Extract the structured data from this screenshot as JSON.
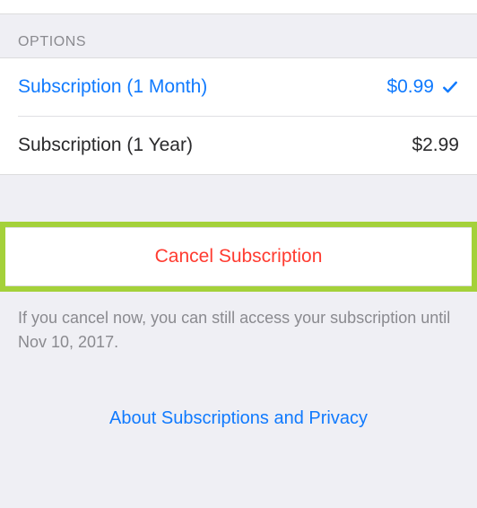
{
  "section_header": "Options",
  "options": [
    {
      "label": "Subscription (1 Month)",
      "price": "$0.99",
      "selected": true
    },
    {
      "label": "Subscription (1 Year)",
      "price": "$2.99",
      "selected": false
    }
  ],
  "cancel_button_label": "Cancel Subscription",
  "cancel_notice": "If you cancel now, you can still access your subscription until Nov 10, 2017.",
  "about_link_label": "About Subscriptions and Privacy",
  "colors": {
    "accent": "#107afe",
    "destructive": "#ff3b30",
    "highlight_border": "#a4d13a"
  }
}
